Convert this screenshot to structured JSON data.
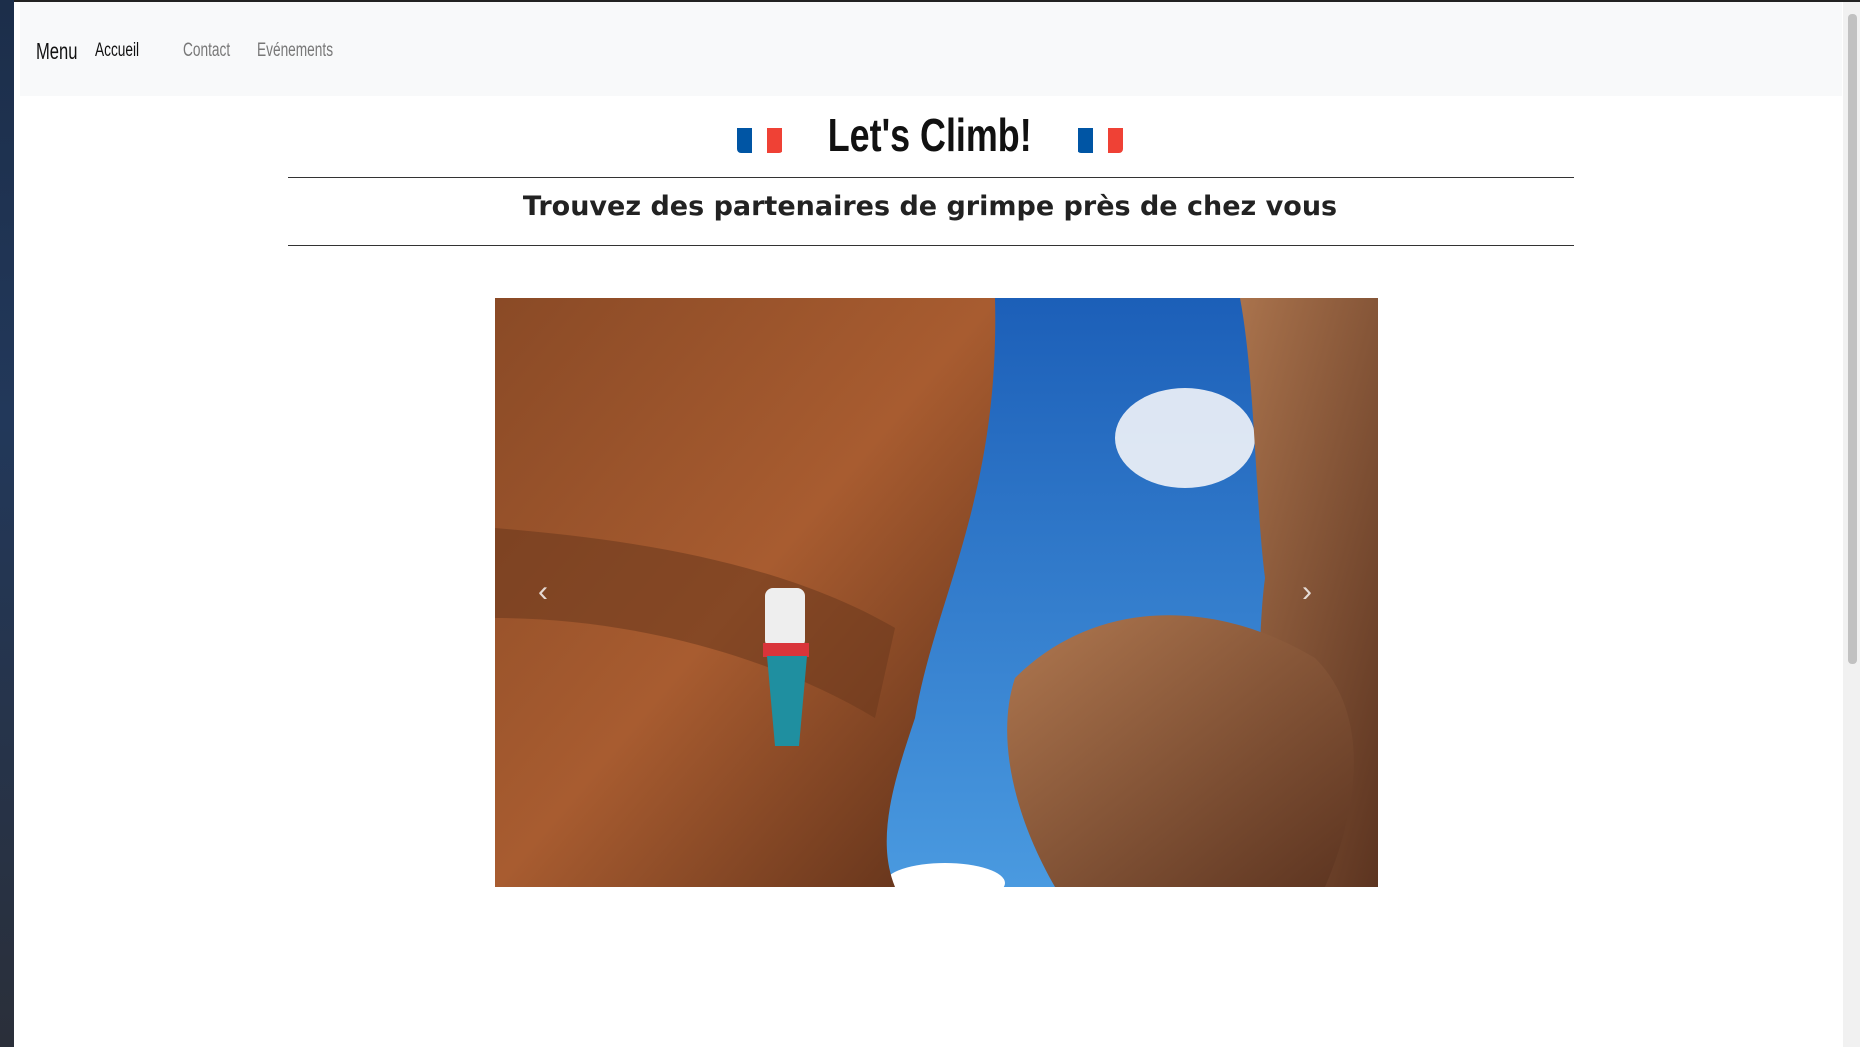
{
  "navbar": {
    "brand": "Menu",
    "items": [
      {
        "label": "Accueil",
        "active": true
      },
      {
        "label": "Contact",
        "active": false
      },
      {
        "label": "Evénements",
        "active": false
      }
    ]
  },
  "header": {
    "title": "Let's Climb!",
    "flag_icon": "france-flag",
    "subtitle": "Trouvez des partenaires de grimpe près de chez vous"
  },
  "carousel": {
    "prev_icon": "chevron-left-icon",
    "next_icon": "chevron-right-icon"
  },
  "colors": {
    "navbar_bg": "#f8f9fa",
    "flag_blue": "#0055a4",
    "flag_red": "#ef4135"
  }
}
